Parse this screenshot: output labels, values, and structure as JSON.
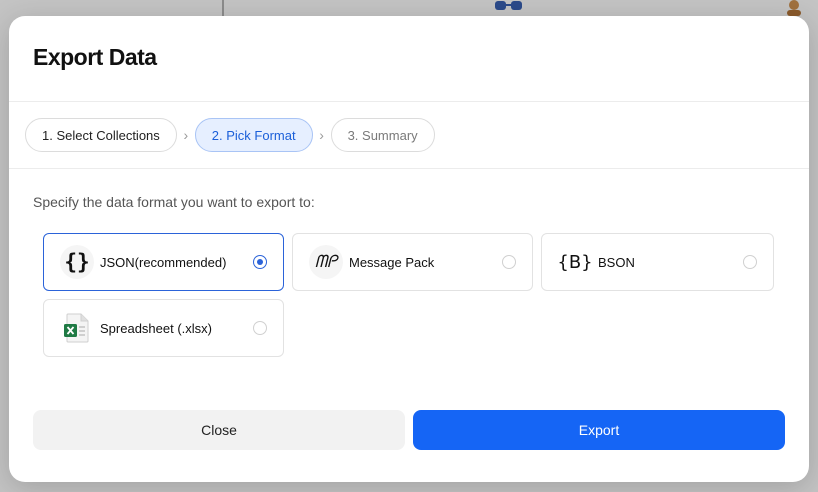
{
  "dialog": {
    "title": "Export Data"
  },
  "stepper": {
    "steps": [
      {
        "label": "1. Select Collections",
        "state": "done"
      },
      {
        "label": "2. Pick Format",
        "state": "active"
      },
      {
        "label": "3. Summary",
        "state": "pending"
      }
    ],
    "separator": "›"
  },
  "format_section": {
    "prompt": "Specify the data format you want to export to:",
    "options": [
      {
        "label": "JSON(recommended)",
        "icon": "curly-braces-icon",
        "selected": true
      },
      {
        "label": "Message Pack",
        "icon": "message-pack-logo-icon",
        "selected": false
      },
      {
        "label": "BSON",
        "icon": "bson-braces-icon",
        "selected": false
      },
      {
        "label": "Spreadsheet (.xlsx)",
        "icon": "excel-file-icon",
        "selected": false
      }
    ],
    "icon_glyphs": {
      "json": "{}",
      "msgpack": "ᗰᑭ",
      "bson": "{B}"
    }
  },
  "footer": {
    "close_label": "Close",
    "export_label": "Export"
  },
  "colors": {
    "accent": "#1565f5",
    "selected_border": "#2b63d9",
    "step_active_bg": "#e6efff",
    "excel_green": "#1f7a44"
  }
}
